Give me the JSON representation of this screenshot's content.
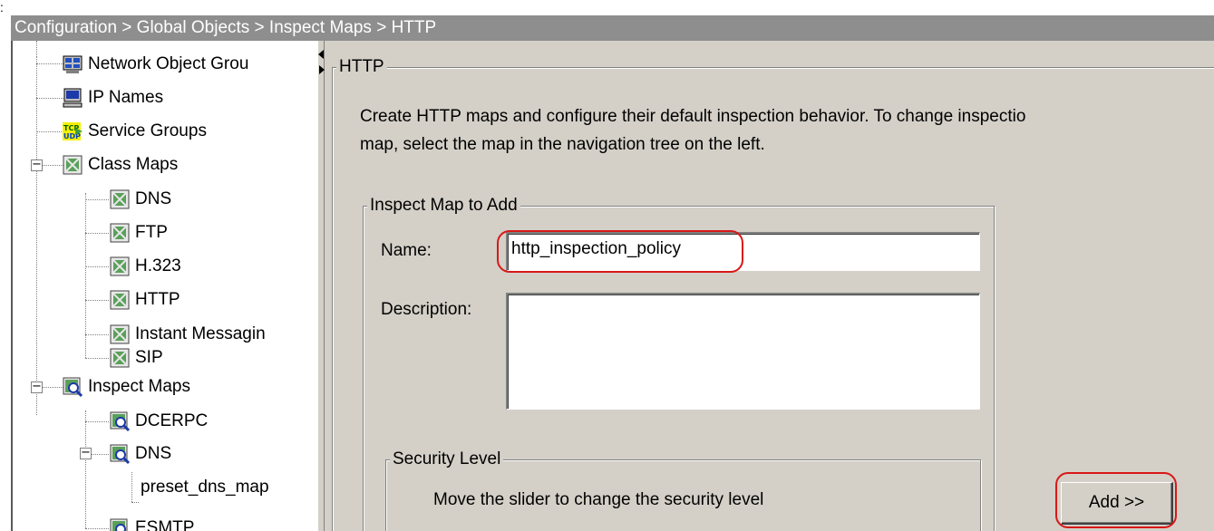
{
  "breadcrumb": "Configuration > Global Objects > Inspect Maps > HTTP",
  "tree": {
    "items": [
      {
        "label": "Network Object Grou",
        "icon": "network-object-group-icon"
      },
      {
        "label": "IP Names",
        "icon": "ip-names-icon"
      },
      {
        "label": "Service Groups",
        "icon": "tcp-udp-service-groups-icon"
      },
      {
        "label": "Class Maps",
        "icon": "class-map-icon",
        "expander": "−"
      },
      {
        "label": "DNS",
        "icon": "class-map-icon"
      },
      {
        "label": "FTP",
        "icon": "class-map-icon"
      },
      {
        "label": "H.323",
        "icon": "class-map-icon"
      },
      {
        "label": "HTTP",
        "icon": "class-map-icon"
      },
      {
        "label": "Instant Messagin",
        "icon": "class-map-icon"
      },
      {
        "label": "SIP",
        "icon": "class-map-icon"
      },
      {
        "label": "Inspect Maps",
        "icon": "inspect-map-icon",
        "expander": "−"
      },
      {
        "label": "DCERPC",
        "icon": "inspect-map-icon"
      },
      {
        "label": "DNS",
        "icon": "inspect-map-icon",
        "expander": "−"
      },
      {
        "label": "preset_dns_map",
        "icon": ""
      },
      {
        "label": "ESMTP",
        "icon": "inspect-map-icon"
      }
    ]
  },
  "http_panel": {
    "legend": "HTTP",
    "description_line1": "Create HTTP maps and configure their default inspection behavior. To change inspectio",
    "description_line2": "map, select the map in the navigation tree on the left."
  },
  "add_group": {
    "legend": "Inspect Map to Add",
    "name_label": "Name:",
    "name_value": "http_inspection_policy",
    "description_label": "Description:",
    "description_value": ""
  },
  "security_level": {
    "legend": "Security Level",
    "hint": "Move the slider to change the security level"
  },
  "add_button": "Add >>",
  "colors": {
    "callout": "#d81818",
    "titlebar": "#8e8e8e",
    "panel": "#d4d0c8"
  }
}
